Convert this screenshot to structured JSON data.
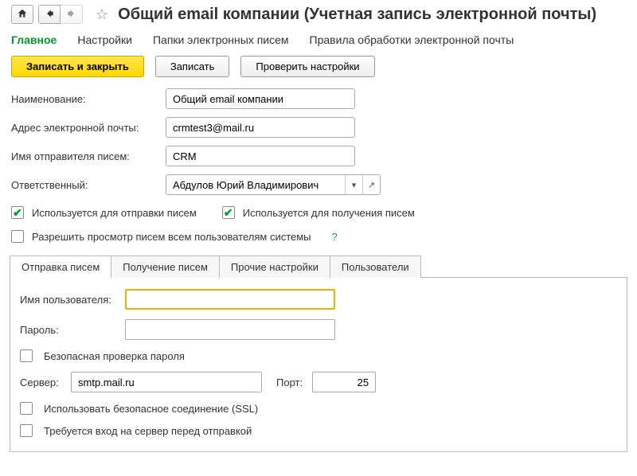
{
  "header": {
    "title": "Общий email компании (Учетная запись электронной почты)"
  },
  "nav": {
    "main": "Главное",
    "settings": "Настройки",
    "folders": "Папки электронных писем",
    "rules": "Правила обработки электронной почты"
  },
  "actions": {
    "save_close": "Записать и закрыть",
    "save": "Записать",
    "verify": "Проверить настройки"
  },
  "fields": {
    "name_label": "Наименование:",
    "name_value": "Общий email компании",
    "email_label": "Адрес электронной почты:",
    "email_value": "crmtest3@mail.ru",
    "sender_label": "Имя отправителя писем:",
    "sender_value": "CRM",
    "responsible_label": "Ответственный:",
    "responsible_value": "Абдулов Юрий Владимирович"
  },
  "checks": {
    "send": "Используется для отправки писем",
    "receive": "Используется для получения писем",
    "allow_all": "Разрешить просмотр писем всем пользователям системы"
  },
  "subtabs": {
    "send": "Отправка писем",
    "receive": "Получение писем",
    "other": "Прочие настройки",
    "users": "Пользователи"
  },
  "smtp": {
    "user_label": "Имя пользователя:",
    "user_value": "",
    "pwd_label": "Пароль:",
    "pwd_value": "",
    "safe_pwd": "Безопасная проверка пароля",
    "server_label": "Сервер:",
    "server_value": "smtp.mail.ru",
    "port_label": "Порт:",
    "port_value": "25",
    "ssl": "Использовать безопасное соединение (SSL)",
    "login_first": "Требуется вход на сервер перед отправкой"
  },
  "help_q": "?"
}
